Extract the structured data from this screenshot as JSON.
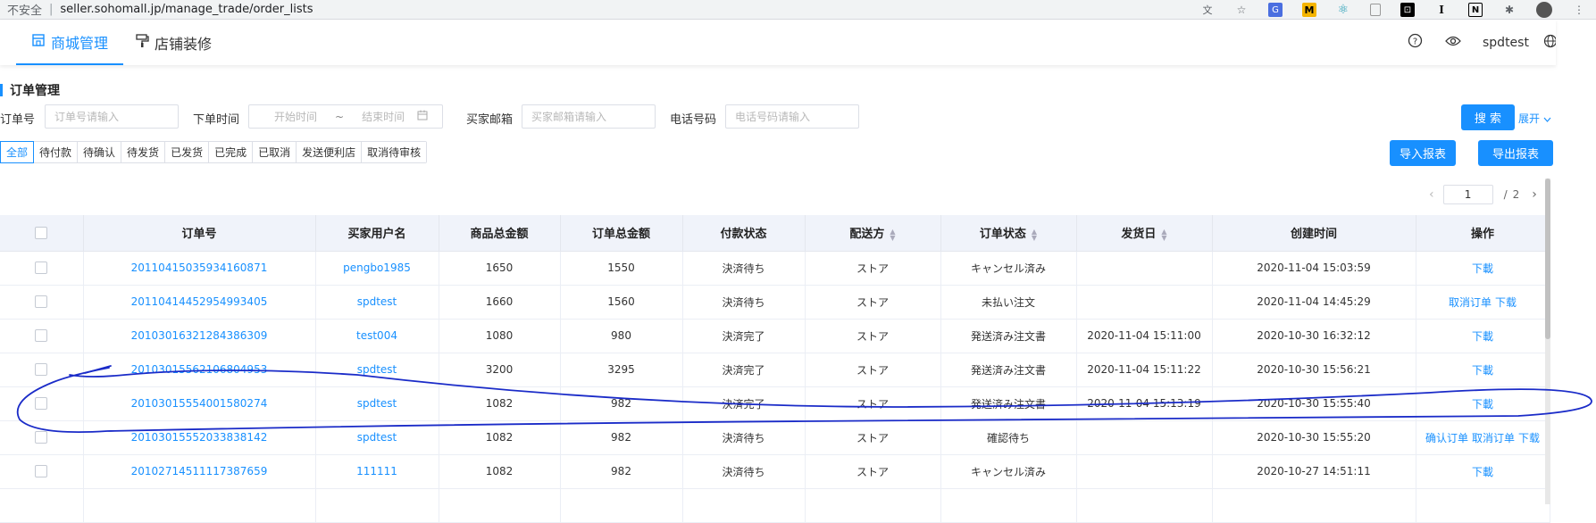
{
  "browser": {
    "insecure_label": "不安全",
    "url": "seller.sohomall.jp/manage_trade/order_lists"
  },
  "header": {
    "tabs": [
      {
        "label": "商城管理",
        "icon": "shop-icon",
        "active": true
      },
      {
        "label": "店铺装修",
        "icon": "paint-roller-icon",
        "active": false
      }
    ],
    "username": "spdtest"
  },
  "section_title": "订单管理",
  "filters": {
    "order_no_label": "订单号",
    "order_no_placeholder": "订单号请输入",
    "order_time_label": "下单时间",
    "start_placeholder": "开始时间",
    "range_sep": "~",
    "end_placeholder": "结束时间",
    "email_label": "买家邮箱",
    "email_placeholder": "买家邮箱请输入",
    "phone_label": "电话号码",
    "phone_placeholder": "电话号码请输入",
    "search_label": "搜 索",
    "expand_label": "展开"
  },
  "actions": {
    "import_label": "导入报表",
    "export_label": "导出报表"
  },
  "status_tabs": [
    "全部",
    "待付款",
    "待确认",
    "待发货",
    "已发货",
    "已完成",
    "已取消",
    "发送便利店",
    "取消待审核"
  ],
  "pagination": {
    "current": "1",
    "sep": "/",
    "total": "2"
  },
  "table": {
    "headers": [
      "订单号",
      "买家用户名",
      "商品总金额",
      "订单总金额",
      "付款状态",
      "配送方",
      "订单状态",
      "发货日",
      "创建时间",
      "操作"
    ],
    "rows": [
      {
        "order_no": "20110415035934160871",
        "buyer": "pengbo1985",
        "goods_total": "1650",
        "order_total": "1550",
        "pay_status": "決済待ち",
        "shipper": "ストア",
        "order_status": "キャンセル済み",
        "ship_date": "",
        "created": "2020-11-04 15:03:59",
        "ops": [
          "下載"
        ]
      },
      {
        "order_no": "20110414452954993405",
        "buyer": "spdtest",
        "goods_total": "1660",
        "order_total": "1560",
        "pay_status": "決済待ち",
        "shipper": "ストア",
        "order_status": "未払い注文",
        "ship_date": "",
        "created": "2020-11-04 14:45:29",
        "ops": [
          "取消订单",
          "下载"
        ]
      },
      {
        "order_no": "20103016321284386309",
        "buyer": "test004",
        "goods_total": "1080",
        "order_total": "980",
        "pay_status": "決済完了",
        "shipper": "ストア",
        "order_status": "発送済み注文書",
        "ship_date": "2020-11-04 15:11:00",
        "created": "2020-10-30 16:32:12",
        "ops": [
          "下載"
        ]
      },
      {
        "order_no": "20103015562106804953",
        "buyer": "spdtest",
        "goods_total": "3200",
        "order_total": "3295",
        "pay_status": "決済完了",
        "shipper": "ストア",
        "order_status": "発送済み注文書",
        "ship_date": "2020-11-04 15:11:22",
        "created": "2020-10-30 15:56:21",
        "ops": [
          "下載"
        ]
      },
      {
        "order_no": "20103015554001580274",
        "buyer": "spdtest",
        "goods_total": "1082",
        "order_total": "982",
        "pay_status": "決済完了",
        "shipper": "ストア",
        "order_status": "発送済み注文書",
        "ship_date": "2020-11-04 15:13:19",
        "created": "2020-10-30 15:55:40",
        "ops": [
          "下載"
        ]
      },
      {
        "order_no": "20103015552033838142",
        "buyer": "spdtest",
        "goods_total": "1082",
        "order_total": "982",
        "pay_status": "決済待ち",
        "shipper": "ストア",
        "order_status": "確認待ち",
        "ship_date": "",
        "created": "2020-10-30 15:55:20",
        "ops": [
          "确认订单",
          "取消订单",
          "下载"
        ]
      },
      {
        "order_no": "20102714511117387659",
        "buyer": "111111",
        "goods_total": "1082",
        "order_total": "982",
        "pay_status": "決済待ち",
        "shipper": "ストア",
        "order_status": "キャンセル済み",
        "ship_date": "",
        "created": "2020-10-27 14:51:11",
        "ops": [
          "下載"
        ]
      }
    ]
  },
  "colors": {
    "primary": "#1890ff",
    "annotation": "#1a2bc8",
    "header_bg": "#f0f3fa"
  }
}
